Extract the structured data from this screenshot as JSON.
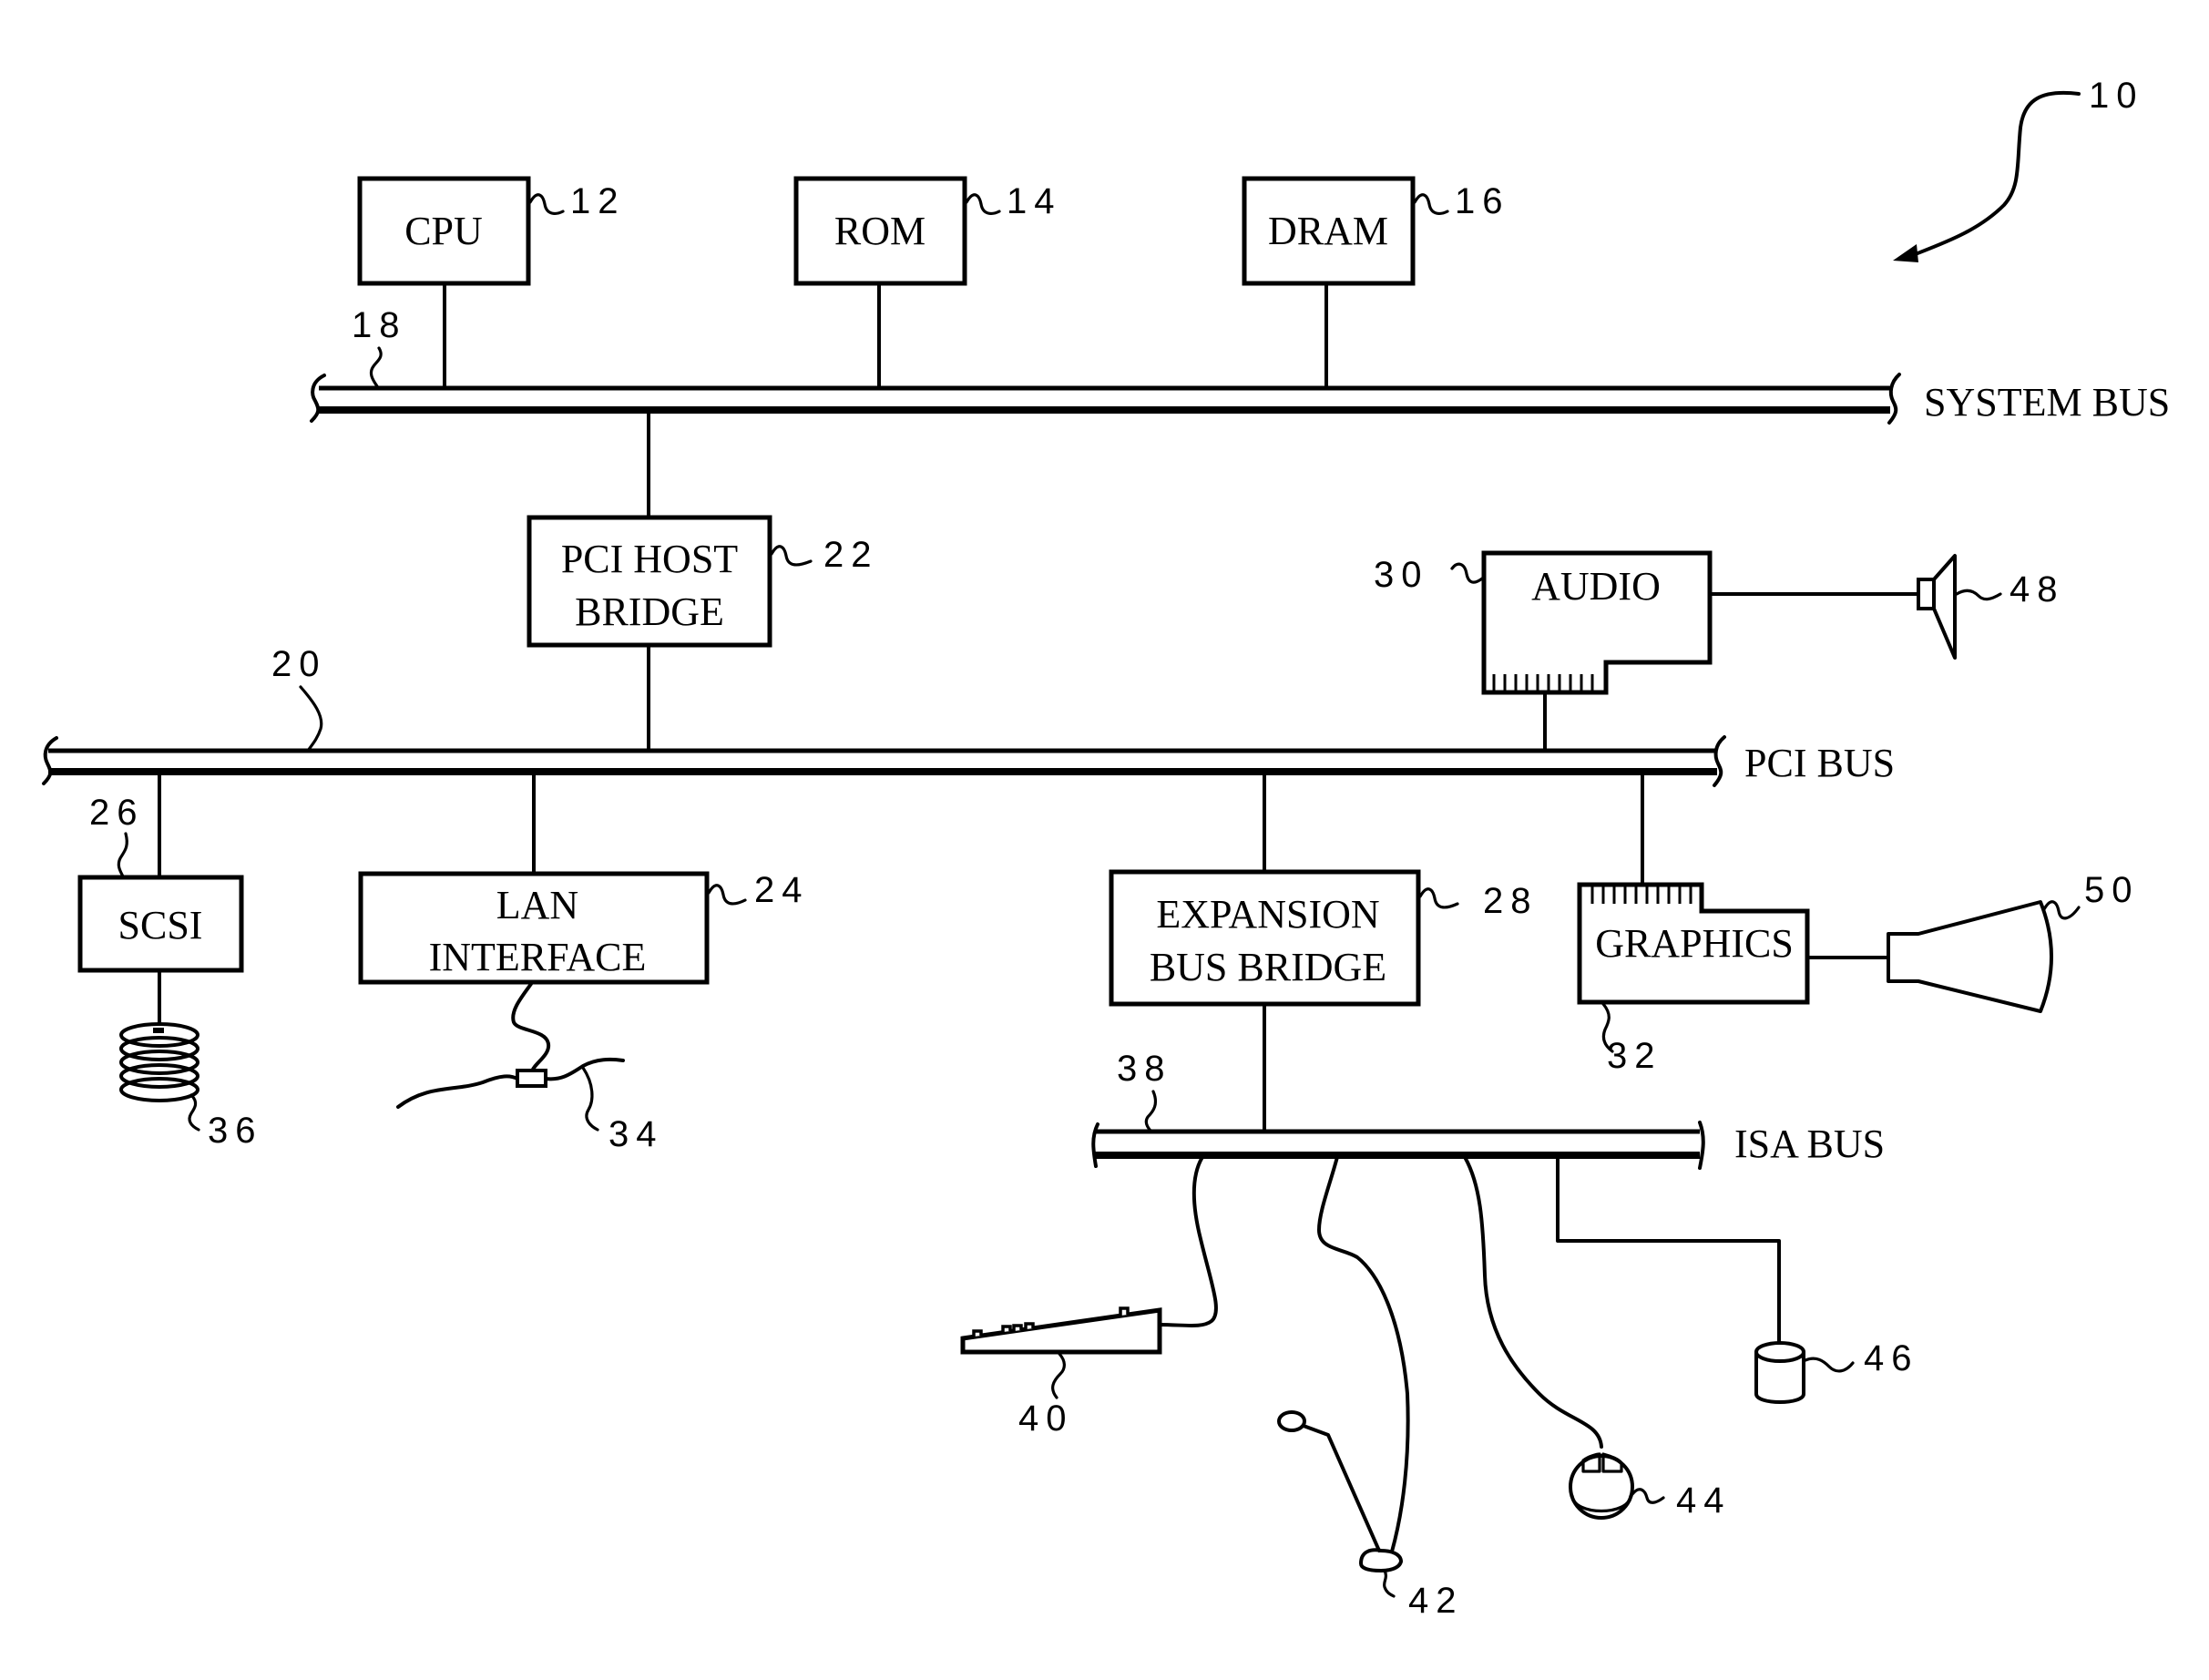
{
  "figure": {
    "reference": "10",
    "buses": {
      "system": {
        "label": "SYSTEM BUS",
        "ref": "18"
      },
      "pci": {
        "label": "PCI BUS",
        "ref": "20"
      },
      "isa": {
        "label": "ISA BUS",
        "ref": "38"
      }
    },
    "blocks": {
      "cpu": {
        "lines": [
          "CPU"
        ],
        "ref": "12"
      },
      "rom": {
        "lines": [
          "ROM"
        ],
        "ref": "14"
      },
      "dram": {
        "lines": [
          "DRAM"
        ],
        "ref": "16"
      },
      "pci_host_bridge": {
        "lines": [
          "PCI HOST",
          "BRIDGE"
        ],
        "ref": "22"
      },
      "lan_interface": {
        "lines": [
          "LAN",
          "INTERFACE"
        ],
        "ref": "24"
      },
      "scsi": {
        "lines": [
          "SCSI"
        ],
        "ref": "26"
      },
      "expansion_bus_bridge": {
        "lines": [
          "EXPANSION",
          "BUS BRIDGE"
        ],
        "ref": "28"
      },
      "audio": {
        "lines": [
          "AUDIO"
        ],
        "ref": "30"
      },
      "graphics": {
        "lines": [
          "GRAPHICS"
        ],
        "ref": "32"
      }
    },
    "devices": {
      "network": {
        "ref": "34"
      },
      "disk_stack": {
        "ref": "36"
      },
      "keyboard": {
        "ref": "40"
      },
      "joystick": {
        "ref": "42"
      },
      "mouse": {
        "ref": "44"
      },
      "disk_drive": {
        "ref": "46"
      },
      "speaker": {
        "ref": "48"
      },
      "monitor": {
        "ref": "50"
      }
    }
  }
}
